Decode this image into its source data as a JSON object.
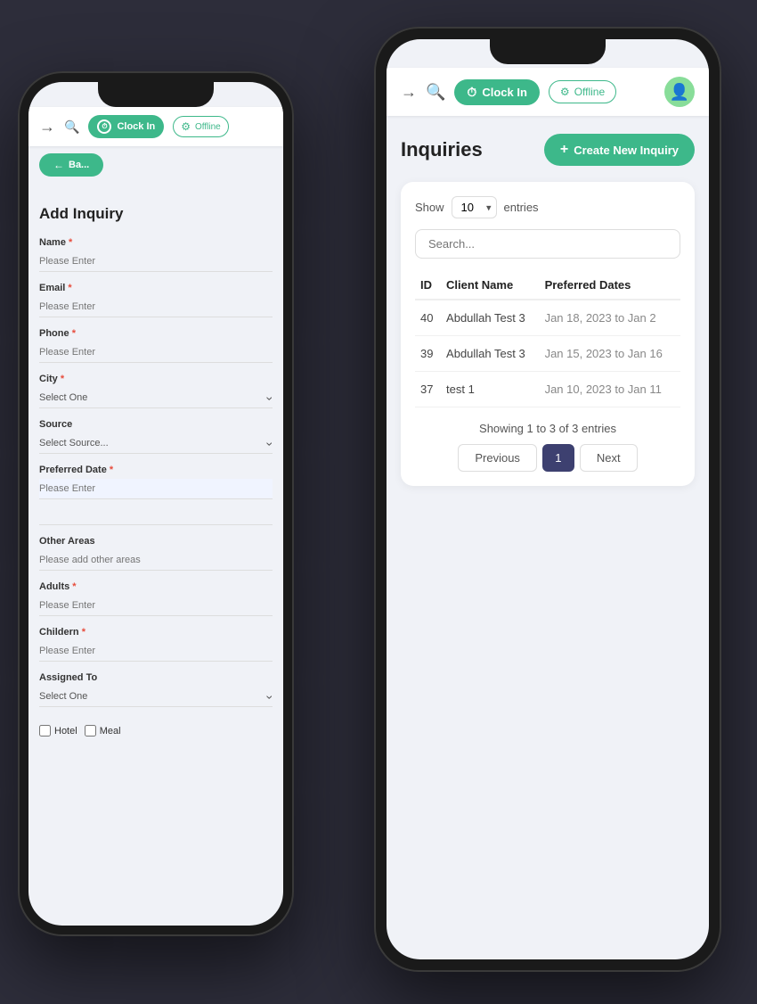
{
  "header": {
    "clock_in_label": "Clock In",
    "offline_label": "Offline",
    "back_arrow": "→",
    "search_icon": "🔍"
  },
  "back_phone": {
    "back_btn_label": "Ba...",
    "title": "Add Inquiry",
    "form": {
      "name_label": "Name",
      "name_placeholder": "Please Enter",
      "email_label": "Email",
      "email_placeholder": "Please Enter",
      "phone_label": "Phone",
      "phone_placeholder": "Please Enter",
      "city_label": "City",
      "city_placeholder": "Select One",
      "source_label": "Source",
      "source_placeholder": "Select Source...",
      "preferred_date_label": "Preferred Date",
      "preferred_date_placeholder": "Please Enter",
      "other_areas_label": "Other Areas",
      "other_areas_placeholder": "Please add other areas",
      "adults_label": "Adults",
      "adults_placeholder": "Please Enter",
      "children_label": "Childern",
      "children_placeholder": "Please Enter",
      "assigned_to_label": "Assigned To",
      "assigned_to_placeholder": "Select One",
      "hotel_label": "Hotel",
      "meal_label": "Meal"
    }
  },
  "front_phone": {
    "page_title": "Inquiries",
    "create_btn_label": "Create New Inquiry",
    "show_label": "Show",
    "entries_label": "entries",
    "entries_value": "10",
    "search_placeholder": "Search...",
    "table": {
      "headers": [
        "ID",
        "Client Name",
        "Preferred Dates"
      ],
      "rows": [
        {
          "id": "40",
          "client_name": "Abdullah Test 3",
          "preferred_dates": "Jan 18, 2023 to Jan 2"
        },
        {
          "id": "39",
          "client_name": "Abdullah Test 3",
          "preferred_dates": "Jan 15, 2023 to Jan 16"
        },
        {
          "id": "37",
          "client_name": "test 1",
          "preferred_dates": "Jan 10, 2023 to Jan 11"
        }
      ]
    },
    "showing_text": "Showing 1 to 3 of 3 entries",
    "prev_btn": "Previous",
    "page_num": "1",
    "next_btn": "Next"
  }
}
